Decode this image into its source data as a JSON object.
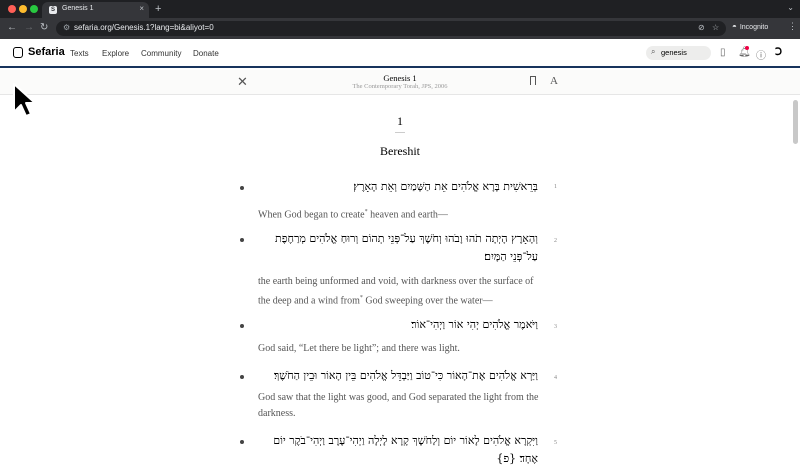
{
  "browser": {
    "tab_title": "Genesis 1",
    "tab_close": "×",
    "new_tab": "+",
    "tab_menu": "⌄",
    "url": "sefaria.org/Genesis.1?lang=bi&aliyot=0",
    "incognito_label": "Incognito",
    "traffic_colors": [
      "#ff5f57",
      "#febc2e",
      "#28c840"
    ]
  },
  "header": {
    "logo": "Sefaria",
    "nav": [
      "Texts",
      "Explore",
      "Community",
      "Donate"
    ],
    "search_value": "genesis"
  },
  "reader": {
    "title": "Genesis 1",
    "subtitle": "The Contemporary Torah, JPS, 2006",
    "chapter_number": "1",
    "chapter_name": "Bereshit"
  },
  "verses": [
    {
      "num": "1",
      "hebrew": "בְּרֵאשִׁית בָּרָא אֱלֹהִים אֵת הַשָּׁמַיִם וְאֵת הָאָרֶץ׃",
      "english_pre": "When God began to create",
      "note": "*",
      "english_post": " heaven and earth—"
    },
    {
      "num": "2",
      "hebrew": "וְהָאָרֶץ הָיְתָה תֹהוּ וָבֹהוּ וְחֹשֶׁךְ עַל־פְּנֵי תְהוֹם וְרוּחַ אֱלֹהִים מְרַחֶפֶת עַל־פְּנֵי הַמָּיִם׃",
      "english_pre": "the earth being unformed and void, with darkness over the surface of the deep and a wind from",
      "note": "*",
      "english_post": " God sweeping over the water—"
    },
    {
      "num": "3",
      "hebrew": "וַיֹּאמֶר אֱלֹהִים יְהִי אוֹר וַיְהִי־אוֹר׃",
      "english_pre": "God said, “Let there be light”; and there was light.",
      "note": "",
      "english_post": ""
    },
    {
      "num": "4",
      "hebrew": "וַיַּרְא אֱלֹהִים אֶת־הָאוֹר כִּי־טוֹב וַיַּבְדֵּל אֱלֹהִים בֵּין הָאוֹר וּבֵין הַחֹשֶׁךְ׃",
      "english_pre": "God saw that the light was good, and God separated the light from the darkness.",
      "note": "",
      "english_post": ""
    },
    {
      "num": "5",
      "hebrew": "וַיִּקְרָא אֱלֹהִים לָאוֹר יוֹם וְלַחֹשֶׁךְ קָרָא לָיְלָה וַיְהִי־עֶרֶב וַיְהִי־בֹקֶר יוֹם אֶחָד׃ {פ}",
      "english_pre": "",
      "note": "",
      "english_post": ""
    }
  ]
}
